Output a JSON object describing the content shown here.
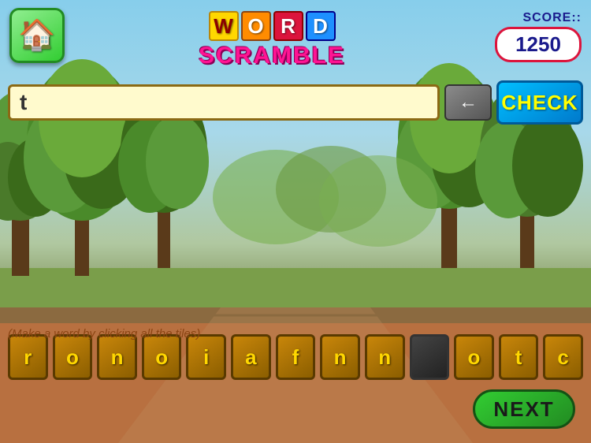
{
  "title": {
    "letters": [
      {
        "char": "W",
        "class": "tl-yellow"
      },
      {
        "char": "O",
        "class": "tl-orange"
      },
      {
        "char": "R",
        "class": "tl-red"
      },
      {
        "char": "D",
        "class": "tl-blue"
      }
    ],
    "scramble": "SCRAMBLE"
  },
  "score": {
    "label": "SCORE::",
    "value": "1250"
  },
  "input": {
    "current_value": "t",
    "placeholder": ""
  },
  "buttons": {
    "check": "CHECK",
    "next": "NEXT",
    "home": "🏠"
  },
  "tiles": [
    {
      "letter": "r",
      "used": false
    },
    {
      "letter": "o",
      "used": false
    },
    {
      "letter": "n",
      "used": false
    },
    {
      "letter": "o",
      "used": false
    },
    {
      "letter": "i",
      "used": false
    },
    {
      "letter": "a",
      "used": false
    },
    {
      "letter": "f",
      "used": false
    },
    {
      "letter": "n",
      "used": false
    },
    {
      "letter": "n",
      "used": false
    },
    {
      "letter": "",
      "used": true
    },
    {
      "letter": "o",
      "used": false
    },
    {
      "letter": "t",
      "used": false
    },
    {
      "letter": "c",
      "used": false
    }
  ],
  "hint": "(Make a word by clicking all the tiles)",
  "colors": {
    "tile_bg": "#c8860a",
    "tile_border": "#5a3a00",
    "tile_text": "#ffd700",
    "check_bg": "#007acc",
    "next_bg": "#32cd32",
    "input_bg": "#fffacd"
  }
}
